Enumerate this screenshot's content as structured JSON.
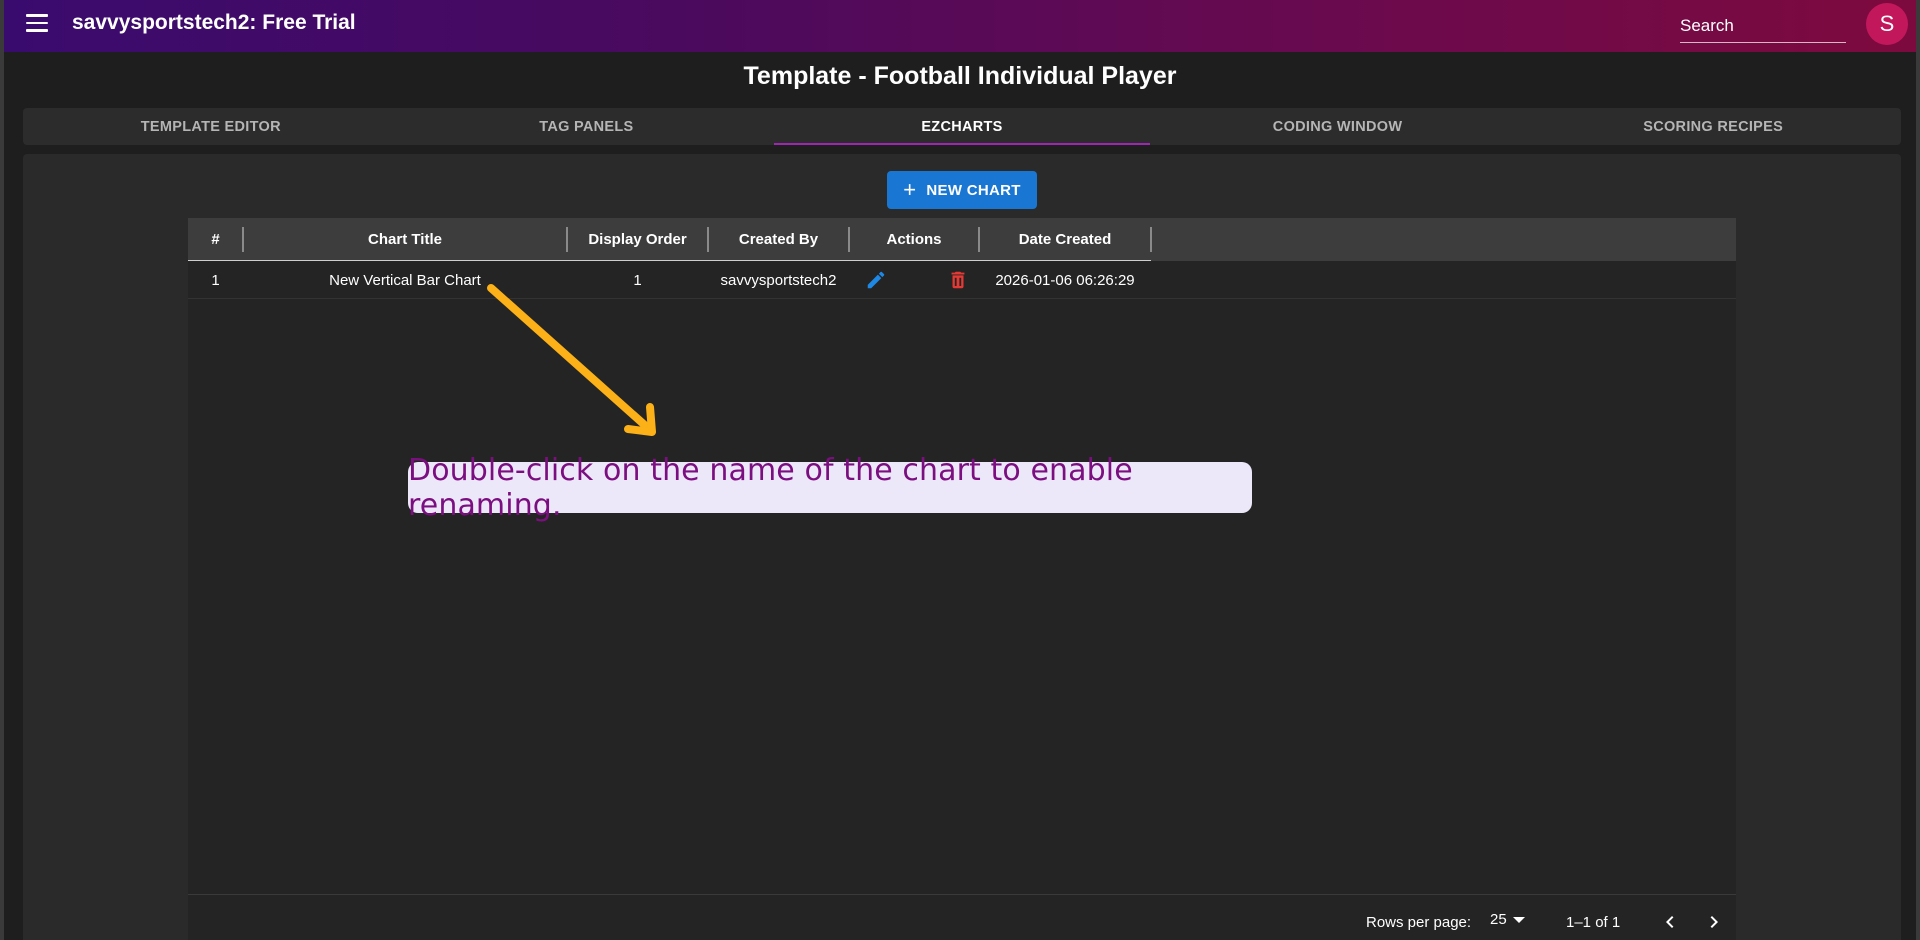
{
  "appbar": {
    "title": "savvysportstech2: Free Trial",
    "search_placeholder": "Search",
    "avatar_initial": "S"
  },
  "page": {
    "title": "Template - Football Individual Player"
  },
  "tabs": [
    {
      "label": "TEMPLATE EDITOR",
      "active": false
    },
    {
      "label": "TAG PANELS",
      "active": false
    },
    {
      "label": "EZCHARTS",
      "active": true
    },
    {
      "label": "CODING WINDOW",
      "active": false
    },
    {
      "label": "SCORING RECIPES",
      "active": false
    }
  ],
  "toolbar": {
    "new_chart_label": "NEW CHART"
  },
  "grid": {
    "columns": [
      "#",
      "Chart Title",
      "Display Order",
      "Created By",
      "Actions",
      "Date Created"
    ],
    "rows": [
      {
        "num": "1",
        "title": "New Vertical Bar Chart",
        "order": "1",
        "created_by": "savvysportstech2",
        "date": "2026-01-06 06:26:29"
      }
    ]
  },
  "pagination": {
    "rows_per_page_label": "Rows per page:",
    "rows_per_page": "25",
    "range": "1–1 of 1"
  },
  "annotation": {
    "text": "Double-click on the name of the chart to enable renaming."
  },
  "colors": {
    "accent_tab": "#9c27b0",
    "primary_button": "#1976d2",
    "avatar": "#c2185b",
    "edit_icon": "#1e88e5",
    "delete_icon": "#e53935",
    "arrow": "#fbb117",
    "annotation_text": "#7b0f7f"
  },
  "icons": {
    "menu": "menu-icon",
    "plus": "plus-icon",
    "edit": "pencil-icon",
    "delete": "trash-icon",
    "prev": "chevron-left-icon",
    "next": "chevron-right-icon",
    "dropdown": "caret-down-icon"
  }
}
